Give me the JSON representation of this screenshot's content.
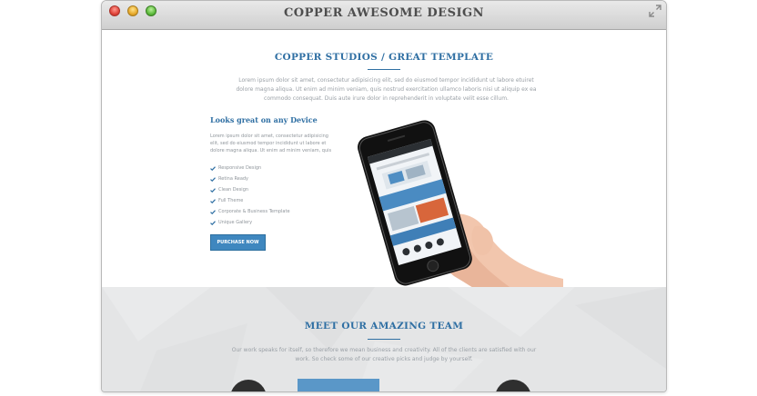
{
  "window": {
    "title": "COPPER AWESOME DESIGN"
  },
  "hero": {
    "title": "COPPER STUDIOS / GREAT TEMPLATE",
    "intro": "Lorem ipsum dolor sit amet, consectetur adipisicing elit, sed do eiusmod tempor incididunt ut labore etuiret dolore magna aliqua. Ut enim ad minim veniam, quis nostrud exercitation ullamco laboris nisi ut aliquip ex ea commodo consequat. Duis aute irure dolor in reprehenderit in voluptate velit esse cillum."
  },
  "device": {
    "heading": "Looks great on any Device",
    "paragraph": "Lorem ipsum dolor sit amet, consectetur adipisicing elit, sed do eiusmod tempor incididunt ut labore et dolore magna aliqua. Ut enim ad minim veniam, quis",
    "features": [
      "Responsive Design",
      "Retina Ready",
      "Clean Design",
      "Full Theme",
      "Corporate & Business Template",
      "Unique Gallery"
    ],
    "button_label": "PURCHASE NOW"
  },
  "team": {
    "title": "MEET OUR AMAZING TEAM",
    "description": "Our work speaks for itself, so therefore we mean business and creativity. All of the clients are satisfied with our work. So check some of our creative picks and judge by yourself."
  },
  "colors": {
    "accent": "#2f6fa3",
    "button": "#3f87bf",
    "team_bg": "#e4e5e6"
  }
}
